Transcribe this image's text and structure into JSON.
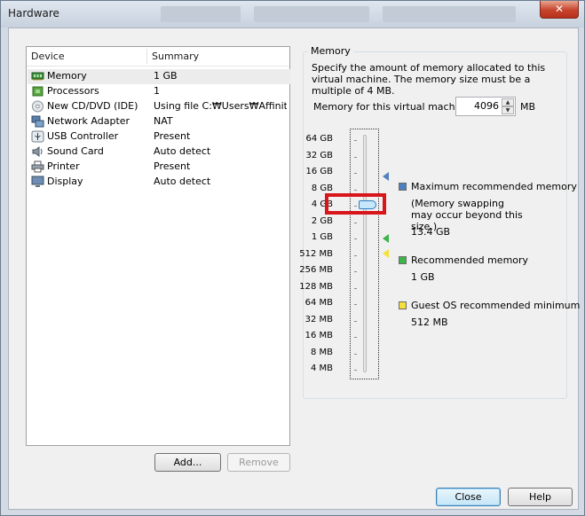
{
  "window": {
    "title": "Hardware",
    "close_symbol": "✕"
  },
  "devices": {
    "col_device": "Device",
    "col_summary": "Summary",
    "rows": [
      {
        "name": "Memory",
        "summary": "1 GB",
        "icon": "memory-icon"
      },
      {
        "name": "Processors",
        "summary": "1",
        "icon": "processor-icon"
      },
      {
        "name": "New CD/DVD (IDE)",
        "summary": "Using file C:₩Users₩Affinit...",
        "icon": "cd-dvd-icon"
      },
      {
        "name": "Network Adapter",
        "summary": "NAT",
        "icon": "network-adapter-icon"
      },
      {
        "name": "USB Controller",
        "summary": "Present",
        "icon": "usb-icon"
      },
      {
        "name": "Sound Card",
        "summary": "Auto detect",
        "icon": "sound-card-icon"
      },
      {
        "name": "Printer",
        "summary": "Present",
        "icon": "printer-icon"
      },
      {
        "name": "Display",
        "summary": "Auto detect",
        "icon": "display-icon"
      }
    ],
    "add_label": "Add...",
    "remove_label": "Remove"
  },
  "memory": {
    "group_title": "Memory",
    "description": "Specify the amount of memory allocated to this virtual machine. The memory size must be a multiple of 4 MB.",
    "field_label": "Memory for this virtual machine:",
    "field_value": "4096",
    "unit": "MB",
    "scale_labels": [
      "64 GB",
      "32 GB",
      "16 GB",
      "8 GB",
      "4 GB",
      "2 GB",
      "1 GB",
      "512 MB",
      "256 MB",
      "128 MB",
      "64 MB",
      "32 MB",
      "16 MB",
      "8 MB",
      "4 MB"
    ],
    "selected_label": "4 GB",
    "legend": {
      "max_title": "Maximum recommended memory",
      "max_note": "(Memory swapping may occur beyond this size.)",
      "max_value": "13.4 GB",
      "rec_title": "Recommended memory",
      "rec_value": "1 GB",
      "guest_title": "Guest OS recommended minimum",
      "guest_value": "512 MB"
    },
    "colors": {
      "max": "#4f81bd",
      "recommended": "#3cb54a",
      "guest": "#f5e13a",
      "highlight": "#d9151c"
    }
  },
  "footer": {
    "close_label": "Close",
    "help_label": "Help"
  }
}
